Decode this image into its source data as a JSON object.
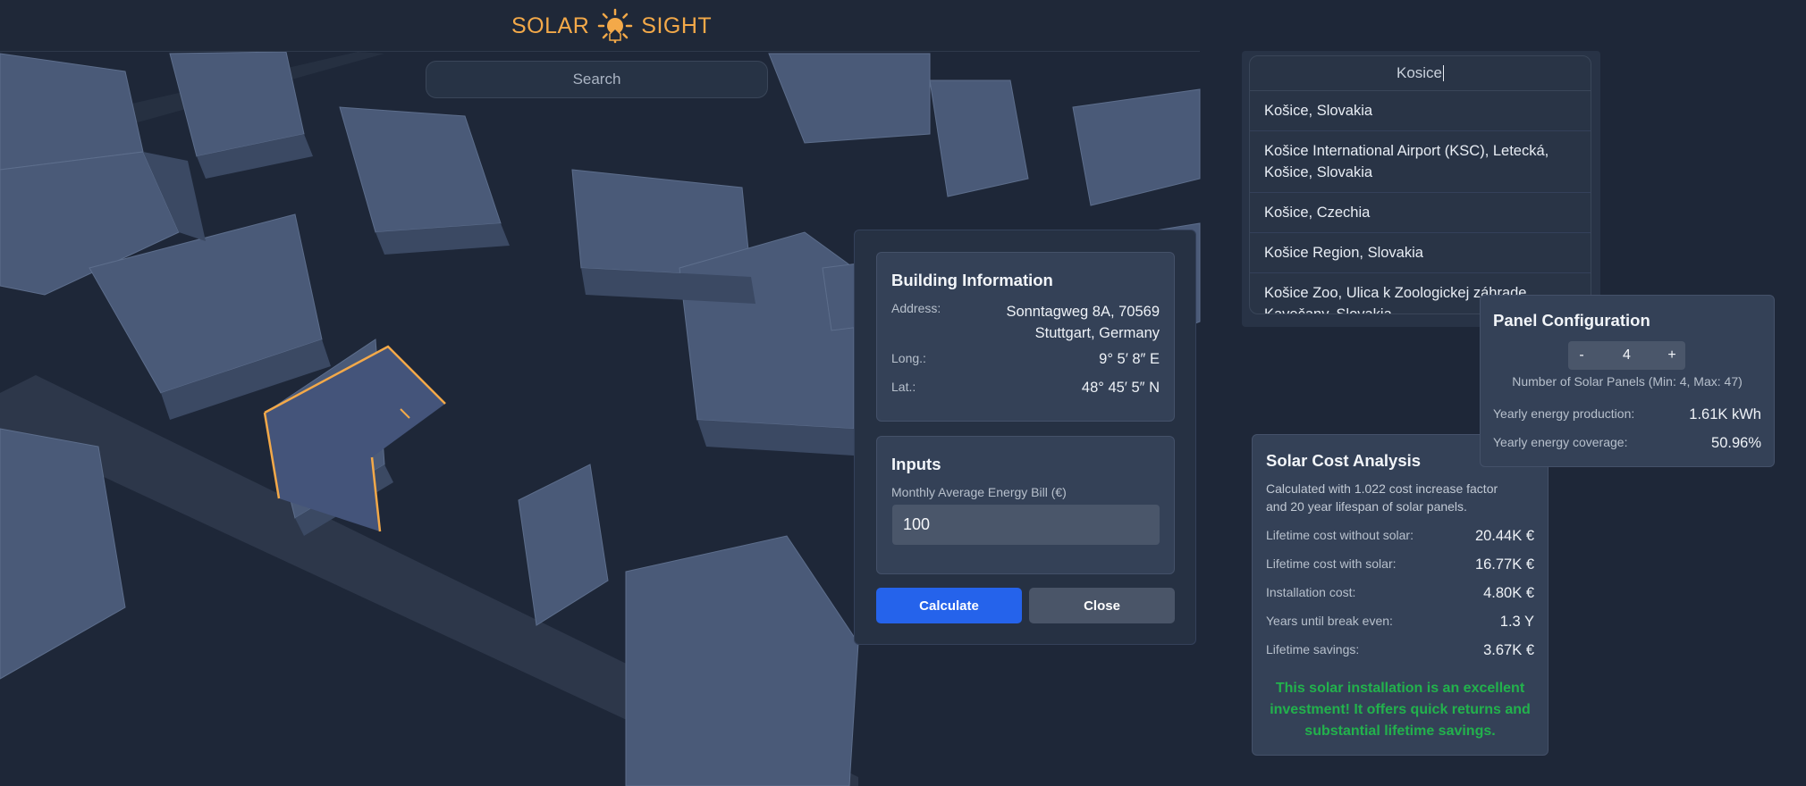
{
  "app": {
    "logo_left": "SOLAR",
    "logo_right": "SIGHT",
    "accent": "#f3a949"
  },
  "map_search": {
    "placeholder": "Search"
  },
  "location_search": {
    "value": "Kosice",
    "results": [
      "Košice, Slovakia",
      "Košice International Airport (KSC), Letecká, Košice, Slovakia",
      "Košice, Czechia",
      "Košice Region, Slovakia",
      "Košice Zoo, Ulica k Zoologickej záhrade, Kavečany, Slovakia"
    ]
  },
  "building_info": {
    "title": "Building Information",
    "address_label": "Address:",
    "address_line1": "Sonntagweg 8A, 70569",
    "address_line2": "Stuttgart, Germany",
    "long_label": "Long.:",
    "long_value": "9° 5′ 8″ E",
    "lat_label": "Lat.:",
    "lat_value": "48° 45′ 5″ N"
  },
  "inputs": {
    "title": "Inputs",
    "bill_label": "Monthly Average Energy Bill (€)",
    "bill_value": "100"
  },
  "actions": {
    "calculate": "Calculate",
    "close": "Close",
    "calculate_color": "#2563eb",
    "close_color": "#4a5568"
  },
  "panel_config": {
    "title": "Panel Configuration",
    "minus": "-",
    "plus": "+",
    "count": "4",
    "hint": "Number of Solar Panels (Min: 4, Max: 47)",
    "production_label": "Yearly energy production:",
    "production_value": "1.61K kWh",
    "coverage_label": "Yearly energy coverage:",
    "coverage_value": "50.96%"
  },
  "cost_analysis": {
    "title": "Solar Cost Analysis",
    "note_line1": "Calculated with 1.022 cost increase factor",
    "note_line2": "and 20 year lifespan of solar panels.",
    "rows": [
      {
        "label": "Lifetime cost without solar:",
        "value": "20.44K €"
      },
      {
        "label": "Lifetime cost with solar:",
        "value": "16.77K €"
      },
      {
        "label": "Installation cost:",
        "value": "4.80K €"
      },
      {
        "label": "Years until break even:",
        "value": "1.3 Y"
      },
      {
        "label": "Lifetime savings:",
        "value": "3.67K €"
      }
    ],
    "verdict_line1": "This solar installation is an excellent",
    "verdict_line2": "investment! It offers quick returns and",
    "verdict_line3": "substantial lifetime savings.",
    "verdict_color": "#22b24c"
  }
}
